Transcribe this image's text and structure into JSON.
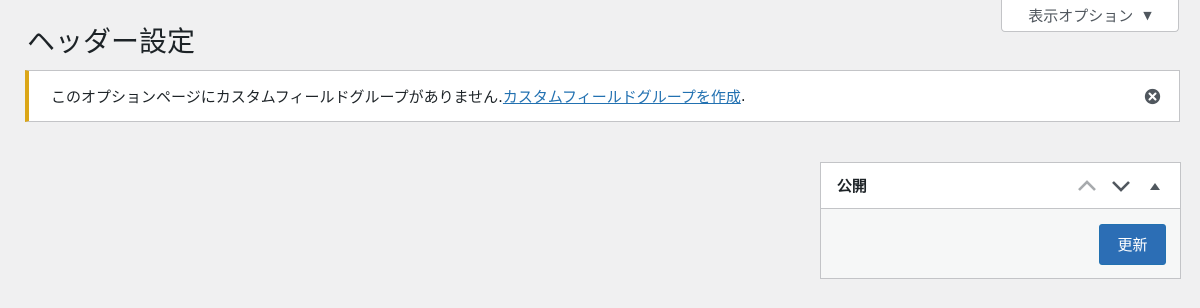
{
  "screen_options": {
    "label": "表示オプション",
    "arrow": "▼"
  },
  "page": {
    "title": "ヘッダー設定"
  },
  "notice": {
    "text": "このオプションページにカスタムフィールドグループがありません. ",
    "link_text": "カスタムフィールドグループを作成",
    "suffix": ".",
    "accent_color": "#dba617"
  },
  "publish_box": {
    "title": "公開",
    "update_label": "更新",
    "button_color": "#2c6eb5"
  }
}
